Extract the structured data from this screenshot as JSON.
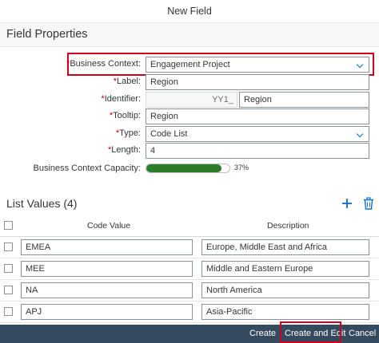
{
  "dialog": {
    "title": "New Field"
  },
  "field_properties": {
    "title": "Field Properties",
    "business_context": {
      "label": "Business Context:",
      "value": "Engagement Project"
    },
    "label": {
      "label": "Label:",
      "value": "Region"
    },
    "identifier": {
      "label": "Identifier:",
      "prefix": "YY1_",
      "value": "Region"
    },
    "tooltip": {
      "label": "Tooltip:",
      "value": "Region"
    },
    "type": {
      "label": "Type:",
      "value": "Code List"
    },
    "length": {
      "label": "Length:",
      "value": "4"
    },
    "capacity": {
      "label": "Business Context Capacity:",
      "percent_text": "37%",
      "fraction": 0.9
    },
    "required_mark": "*"
  },
  "list_values": {
    "title": "List Values (4)",
    "columns": [
      "Code Value",
      "Description"
    ],
    "rows": [
      {
        "code": "EMEA",
        "description": "Europe, Middle East and Africa"
      },
      {
        "code": "MEE",
        "description": "Middle and Eastern Europe"
      },
      {
        "code": "NA",
        "description": "North America"
      },
      {
        "code": "APJ",
        "description": "Asia-Pacific"
      }
    ]
  },
  "footer": {
    "create": "Create",
    "create_and_edit": "Create and Edit",
    "cancel": "Cancel"
  },
  "colors": {
    "highlight": "#d0021b",
    "accent": "#0a6ed1",
    "progress": "#2b7d2b",
    "footer": "#354a5f"
  },
  "icons": {
    "add": "plus-icon",
    "delete": "trash-icon",
    "dropdown": "chevron-down-icon"
  }
}
